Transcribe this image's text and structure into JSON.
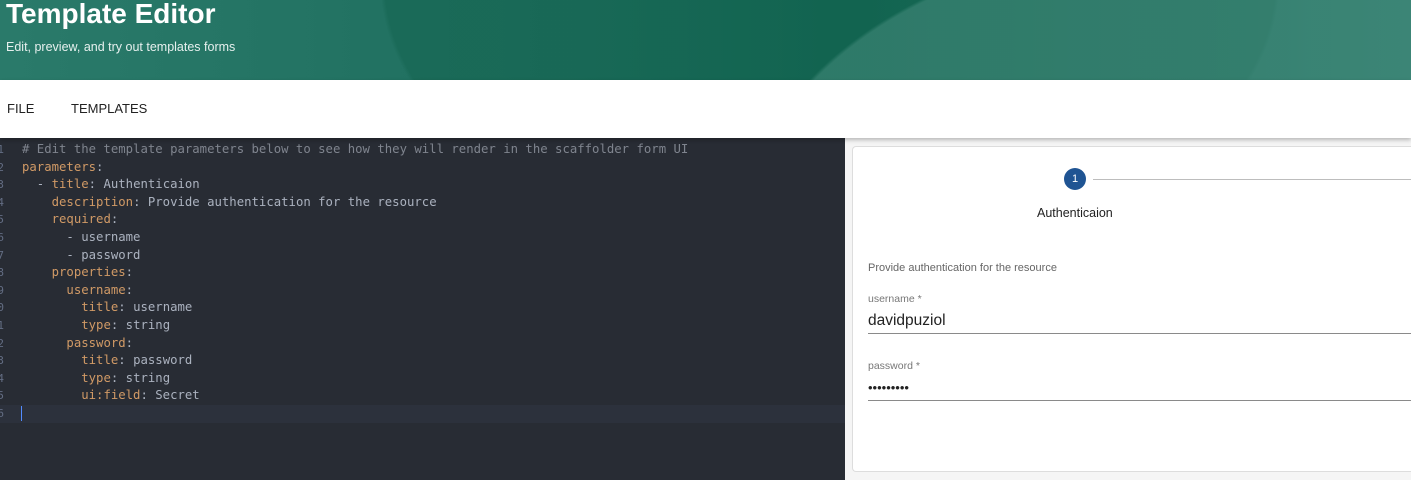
{
  "header": {
    "title": "Template Editor",
    "subtitle": "Edit, preview, and try out templates forms"
  },
  "nav": {
    "tabs": [
      "FILE",
      "TEMPLATES"
    ]
  },
  "editor": {
    "active_line": 16,
    "lines": [
      [
        {
          "t": "comment",
          "v": "# Edit the template parameters below to see how they will render in the scaffolder form UI"
        }
      ],
      [
        {
          "t": "key",
          "v": "parameters"
        },
        {
          "t": "punct",
          "v": ":"
        }
      ],
      [
        {
          "t": "punct",
          "v": "  - "
        },
        {
          "t": "key",
          "v": "title"
        },
        {
          "t": "punct",
          "v": ": "
        },
        {
          "t": "val",
          "v": "Authenticaion"
        }
      ],
      [
        {
          "t": "punct",
          "v": "    "
        },
        {
          "t": "key",
          "v": "description"
        },
        {
          "t": "punct",
          "v": ": "
        },
        {
          "t": "val",
          "v": "Provide authentication for the resource"
        }
      ],
      [
        {
          "t": "punct",
          "v": "    "
        },
        {
          "t": "key",
          "v": "required"
        },
        {
          "t": "punct",
          "v": ":"
        }
      ],
      [
        {
          "t": "punct",
          "v": "      - "
        },
        {
          "t": "val",
          "v": "username"
        }
      ],
      [
        {
          "t": "punct",
          "v": "      - "
        },
        {
          "t": "val",
          "v": "password"
        }
      ],
      [
        {
          "t": "punct",
          "v": "    "
        },
        {
          "t": "key",
          "v": "properties"
        },
        {
          "t": "punct",
          "v": ":"
        }
      ],
      [
        {
          "t": "punct",
          "v": "      "
        },
        {
          "t": "key",
          "v": "username"
        },
        {
          "t": "punct",
          "v": ":"
        }
      ],
      [
        {
          "t": "punct",
          "v": "        "
        },
        {
          "t": "key",
          "v": "title"
        },
        {
          "t": "punct",
          "v": ": "
        },
        {
          "t": "val",
          "v": "username"
        }
      ],
      [
        {
          "t": "punct",
          "v": "        "
        },
        {
          "t": "key",
          "v": "type"
        },
        {
          "t": "punct",
          "v": ": "
        },
        {
          "t": "val",
          "v": "string"
        }
      ],
      [
        {
          "t": "punct",
          "v": "      "
        },
        {
          "t": "key",
          "v": "password"
        },
        {
          "t": "punct",
          "v": ":"
        }
      ],
      [
        {
          "t": "punct",
          "v": "        "
        },
        {
          "t": "key",
          "v": "title"
        },
        {
          "t": "punct",
          "v": ": "
        },
        {
          "t": "val",
          "v": "password"
        }
      ],
      [
        {
          "t": "punct",
          "v": "        "
        },
        {
          "t": "key",
          "v": "type"
        },
        {
          "t": "punct",
          "v": ": "
        },
        {
          "t": "val",
          "v": "string"
        }
      ],
      [
        {
          "t": "punct",
          "v": "        "
        },
        {
          "t": "key",
          "v": "ui:field"
        },
        {
          "t": "punct",
          "v": ": "
        },
        {
          "t": "val",
          "v": "Secret"
        }
      ],
      []
    ]
  },
  "preview": {
    "step_number": "1",
    "step_label": "Authenticaion",
    "description": "Provide authentication for the resource",
    "fields": [
      {
        "label": "username *",
        "value": "davidpuziol",
        "type": "text"
      },
      {
        "label": "password *",
        "value": "davidpuzi",
        "type": "password"
      }
    ],
    "step_color": "#1f5493"
  }
}
